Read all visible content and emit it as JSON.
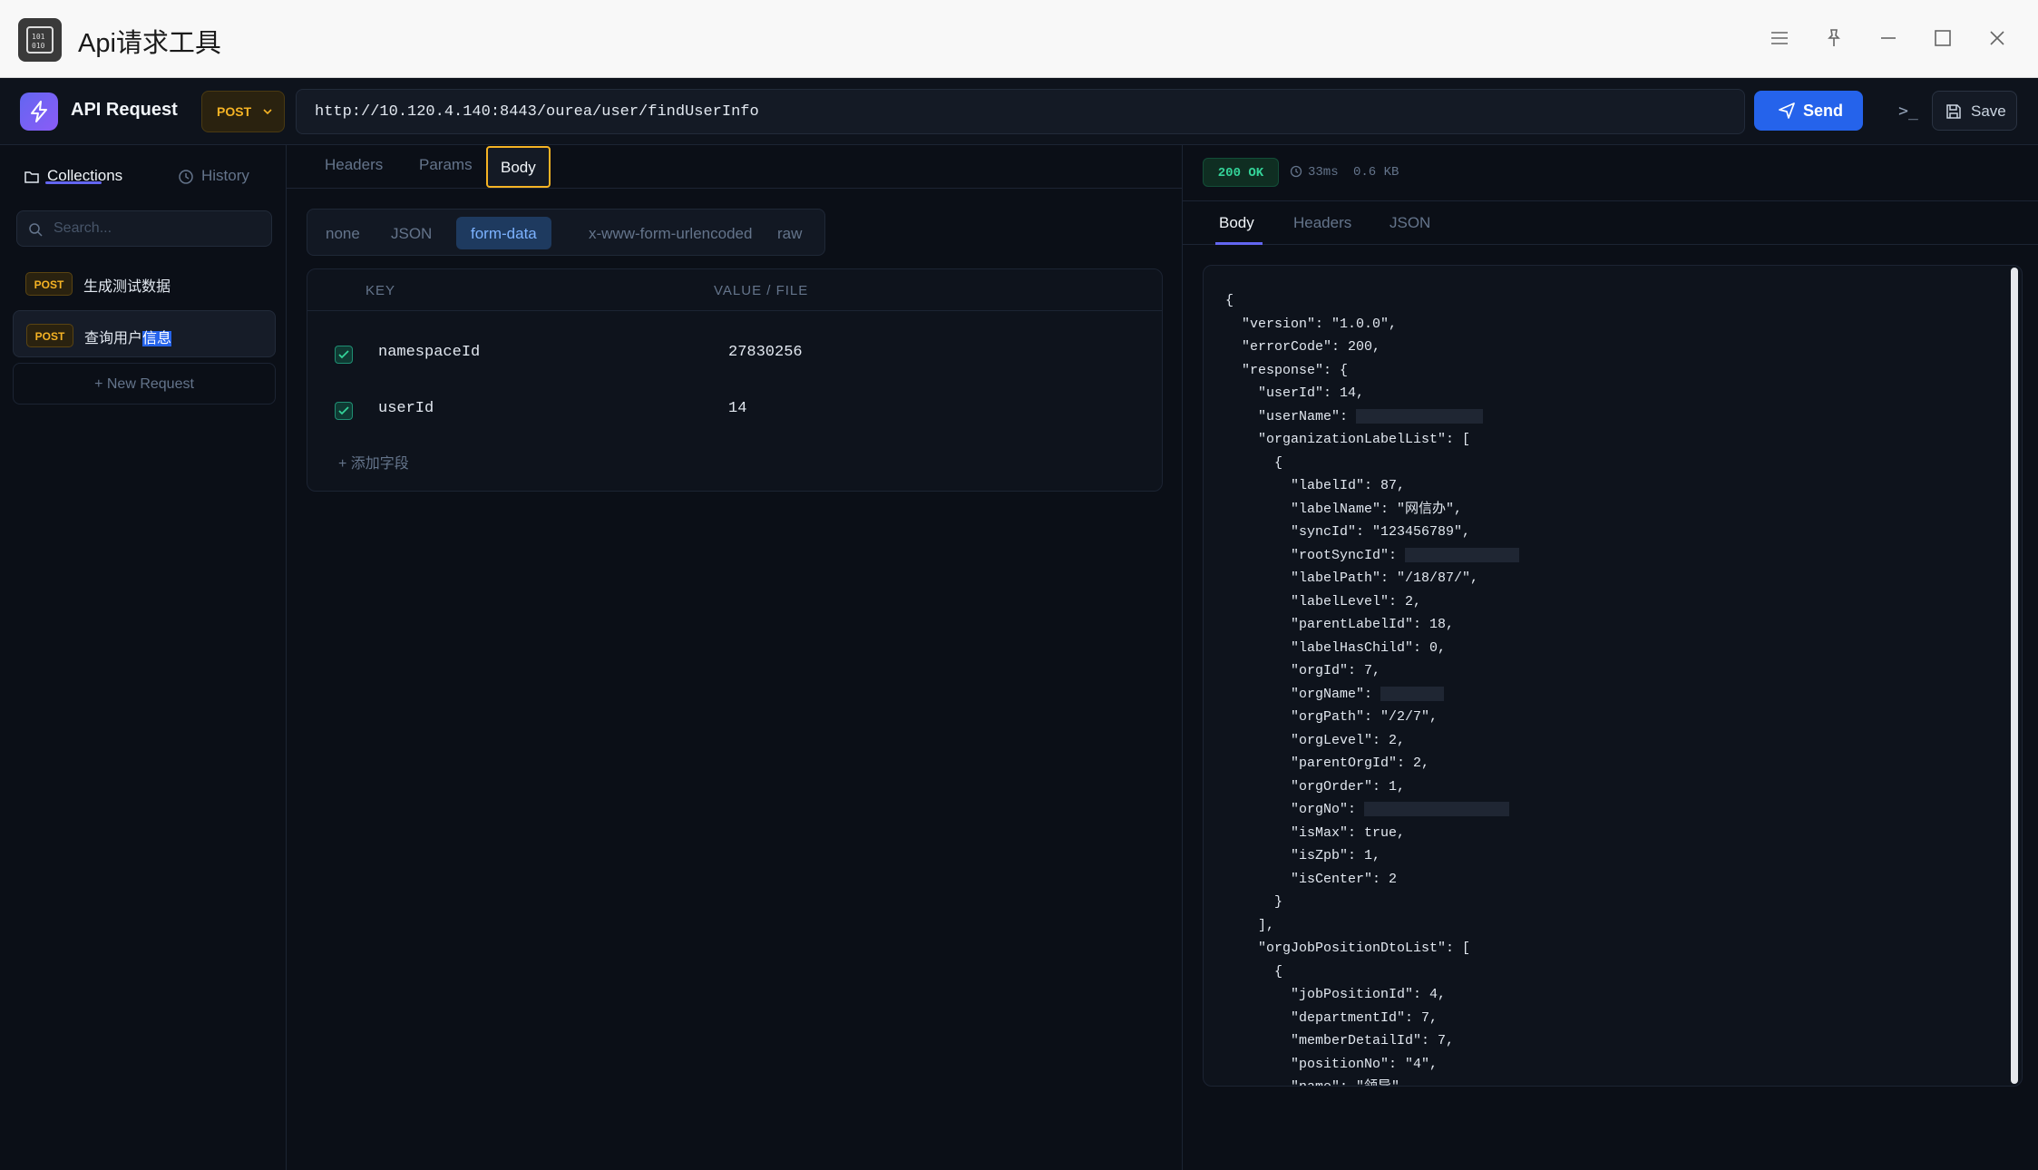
{
  "window": {
    "title": "Api请求工具"
  },
  "toolbar": {
    "brand": "API Request",
    "method": "POST",
    "url": "http://10.120.4.140:8443/ourea/user/findUserInfo",
    "send_label": "Send",
    "terminal_label": ">_",
    "save_label": "Save"
  },
  "sidebar": {
    "tabs": [
      {
        "label": "Collections",
        "icon": "folder-icon"
      },
      {
        "label": "History",
        "icon": "clock-icon"
      }
    ],
    "search_placeholder": "Search...",
    "requests": [
      {
        "method": "POST",
        "name": "生成测试数据"
      },
      {
        "method": "POST",
        "name_prefix": "查询用户",
        "name_highlight": "信息"
      }
    ],
    "new_request": "+ New Request"
  },
  "request": {
    "tabs": [
      "Headers",
      "Params",
      "Body"
    ],
    "active_tab": "Body",
    "body_types": [
      "none",
      "JSON",
      "form-data",
      "x-www-form-urlencoded",
      "raw"
    ],
    "active_body_type": "form-data",
    "table_headers": {
      "key": "KEY",
      "value": "VALUE / FILE"
    },
    "fields": [
      {
        "key": "namespaceId",
        "value": "27830256",
        "checked": true
      },
      {
        "key": "userId",
        "value": "14",
        "checked": true
      }
    ],
    "add_field": "+ 添加字段"
  },
  "response": {
    "status": "200 OK",
    "time": "33ms",
    "size": "0.6 KB",
    "tabs": [
      "Body",
      "Headers",
      "JSON"
    ],
    "active_tab": "Body",
    "json_lines": [
      "{",
      "  \"version\": \"1.0.0\",",
      "  \"errorCode\": 200,",
      "  \"response\": {",
      "    \"userId\": 14,",
      "    \"userName\": ",
      "    \"organizationLabelList\": [",
      "      {",
      "        \"labelId\": 87,",
      "        \"labelName\": \"网信办\",",
      "        \"syncId\": \"123456789\",",
      "        \"rootSyncId\": ",
      "        \"labelPath\": \"/18/87/\",",
      "        \"labelLevel\": 2,",
      "        \"parentLabelId\": 18,",
      "        \"labelHasChild\": 0,",
      "        \"orgId\": 7,",
      "        \"orgName\": ",
      "        \"orgPath\": \"/2/7\",",
      "        \"orgLevel\": 2,",
      "        \"parentOrgId\": 2,",
      "        \"orgOrder\": 1,",
      "        \"orgNo\": ",
      "        \"isMax\": true,",
      "        \"isZpb\": 1,",
      "        \"isCenter\": 2",
      "      }",
      "    ],",
      "    \"orgJobPositionDtoList\": [",
      "      {",
      "        \"jobPositionId\": 4,",
      "        \"departmentId\": 7,",
      "        \"memberDetailId\": 7,",
      "        \"positionNo\": \"4\",",
      "        \"name\": \"领导\","
    ]
  },
  "colors": {
    "accent": "#6366f1",
    "send": "#2563eb",
    "post_badge": "#f5b324",
    "status_ok": "#34d399"
  }
}
